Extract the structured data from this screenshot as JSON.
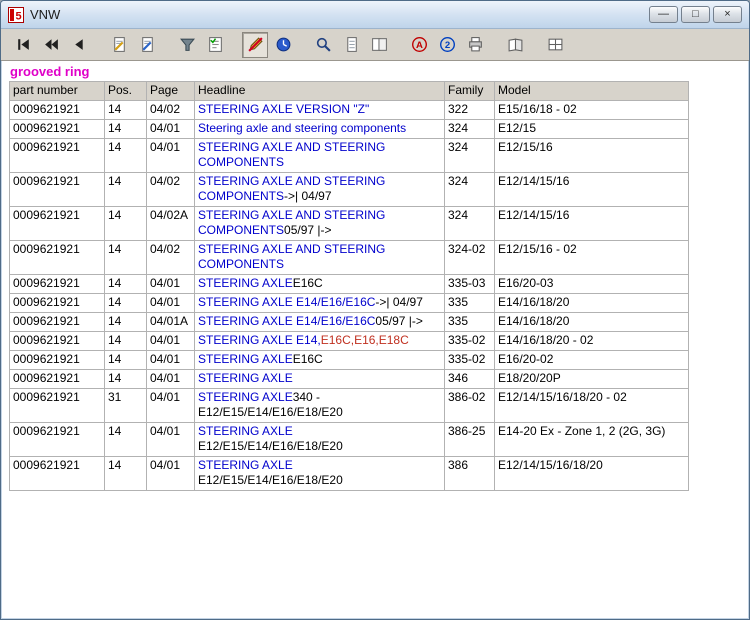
{
  "window": {
    "title": "VNW",
    "controls": [
      {
        "name": "minimize-button",
        "glyph": "—"
      },
      {
        "name": "maximize-button",
        "glyph": "□"
      },
      {
        "name": "close-button",
        "glyph": "×"
      }
    ]
  },
  "query": {
    "term": "grooved ring",
    "color": "#e000c8"
  },
  "toolbar": {
    "items": [
      {
        "name": "go-first-button",
        "icon": "go-first-icon"
      },
      {
        "name": "go-previous-fast-button",
        "icon": "go-previous-fast-icon"
      },
      {
        "name": "go-previous-button",
        "icon": "go-previous-icon"
      },
      {
        "separator": true
      },
      {
        "name": "edit-document-back-button",
        "icon": "document-edit-icon"
      },
      {
        "name": "edit-document-forward-button",
        "icon": "document-edit2-icon"
      },
      {
        "separator": true
      },
      {
        "name": "filter-button",
        "icon": "funnel-icon"
      },
      {
        "name": "checklist-button",
        "icon": "checklist-icon"
      },
      {
        "separator": true
      },
      {
        "name": "no-edit-button",
        "icon": "pen-slash-icon",
        "pressed": true
      },
      {
        "name": "history-button",
        "icon": "clock-icon"
      },
      {
        "separator": true
      },
      {
        "name": "zoom-button",
        "icon": "magnifier-icon"
      },
      {
        "name": "page-view-button",
        "icon": "page-icon"
      },
      {
        "name": "two-page-view-button",
        "icon": "two-pages-icon"
      },
      {
        "separator": true
      },
      {
        "name": "annotation-a-button",
        "icon": "circle-a-icon"
      },
      {
        "name": "annotation-2-button",
        "icon": "circle-2-icon"
      },
      {
        "name": "print-button",
        "icon": "printer-icon"
      },
      {
        "separator": true
      },
      {
        "name": "catalog-button",
        "icon": "book-icon"
      },
      {
        "separator": true
      },
      {
        "name": "grid-view-button",
        "icon": "grid-icon"
      }
    ]
  },
  "table": {
    "columns": [
      "part number",
      "Pos.",
      "Page",
      "Headline",
      "Family",
      "Model"
    ],
    "colors": {
      "link": "#0000cc",
      "text": "#000000",
      "red": "#c03020"
    },
    "rows": [
      {
        "part": "0009621921",
        "pos": "14",
        "page": "04/02",
        "headline": [
          {
            "text": "STEERING AXLE VERSION \"Z\"",
            "color": "link"
          }
        ],
        "family": "322",
        "model": "E15/16/18 - 02"
      },
      {
        "part": "0009621921",
        "pos": "14",
        "page": "04/01",
        "headline": [
          {
            "text": "Steering axle and steering components",
            "color": "link"
          }
        ],
        "family": "324",
        "model": "E12/15"
      },
      {
        "part": "0009621921",
        "pos": "14",
        "page": "04/01",
        "headline": [
          {
            "text": "STEERING AXLE AND STEERING COMPONENTS",
            "color": "link"
          }
        ],
        "family": "324",
        "model": "E12/15/16"
      },
      {
        "part": "0009621921",
        "pos": "14",
        "page": "04/02",
        "headline": [
          {
            "text": "STEERING AXLE AND STEERING COMPONENTS",
            "color": "link"
          },
          {
            "text": "->| 04/97",
            "color": "text"
          }
        ],
        "family": "324",
        "model": "E12/14/15/16"
      },
      {
        "part": "0009621921",
        "pos": "14",
        "page": "04/02A",
        "headline": [
          {
            "text": "STEERING AXLE AND STEERING COMPONENTS",
            "color": "link"
          },
          {
            "text": "05/97 |->",
            "color": "text"
          }
        ],
        "family": "324",
        "model": "E12/14/15/16"
      },
      {
        "part": "0009621921",
        "pos": "14",
        "page": "04/02",
        "headline": [
          {
            "text": "STEERING AXLE AND STEERING COMPONENTS",
            "color": "link"
          }
        ],
        "family": "324-02",
        "model": "E12/15/16 - 02"
      },
      {
        "part": "0009621921",
        "pos": "14",
        "page": "04/01",
        "headline": [
          {
            "text": "STEERING AXLE",
            "color": "link"
          },
          {
            "text": "E16C",
            "color": "text"
          }
        ],
        "family": "335-03",
        "model": "E16/20-03"
      },
      {
        "part": "0009621921",
        "pos": "14",
        "page": "04/01",
        "headline": [
          {
            "text": "STEERING AXLE E14/E16/E16C",
            "color": "link"
          },
          {
            "text": "->| 04/97",
            "color": "text"
          }
        ],
        "family": "335",
        "model": "E14/16/18/20"
      },
      {
        "part": "0009621921",
        "pos": "14",
        "page": "04/01A",
        "headline": [
          {
            "text": "STEERING AXLE E14/E16/E16C",
            "color": "link"
          },
          {
            "text": "05/97 |->",
            "color": "text"
          }
        ],
        "family": "335",
        "model": "E14/16/18/20"
      },
      {
        "part": "0009621921",
        "pos": "14",
        "page": "04/01",
        "headline": [
          {
            "text": "STEERING AXLE E14,",
            "color": "link"
          },
          {
            "text": "E16C,E16,E18C",
            "color": "red"
          }
        ],
        "family": "335-02",
        "model": "E14/16/18/20 - 02"
      },
      {
        "part": "0009621921",
        "pos": "14",
        "page": "04/01",
        "headline": [
          {
            "text": "STEERING AXLE",
            "color": "link"
          },
          {
            "text": "E16C",
            "color": "text"
          }
        ],
        "family": "335-02",
        "model": "E16/20-02"
      },
      {
        "part": "0009621921",
        "pos": "14",
        "page": "04/01",
        "headline": [
          {
            "text": "STEERING AXLE",
            "color": "link"
          }
        ],
        "family": "346",
        "model": "E18/20/20P"
      },
      {
        "part": "0009621921",
        "pos": "31",
        "page": "04/01",
        "headline": [
          {
            "text": "STEERING AXLE",
            "color": "link"
          },
          {
            "text": "340 -\nE12/E15/E14/E16/E18/E20",
            "color": "text"
          }
        ],
        "family": "386-02",
        "model": "E12/14/15/16/18/20 - 02"
      },
      {
        "part": "0009621921",
        "pos": "14",
        "page": "04/01",
        "headline": [
          {
            "text": "STEERING AXLE",
            "color": "link"
          },
          {
            "text": "\nE12/E15/E14/E16/E18/E20",
            "color": "text"
          }
        ],
        "family": "386-25",
        "model": "E14-20 Ex - Zone 1, 2 (2G, 3G)"
      },
      {
        "part": "0009621921",
        "pos": "14",
        "page": "04/01",
        "headline": [
          {
            "text": "STEERING AXLE",
            "color": "link"
          },
          {
            "text": "\nE12/E15/E14/E16/E18/E20",
            "color": "text"
          }
        ],
        "family": "386",
        "model": "E12/14/15/16/18/20"
      }
    ]
  }
}
